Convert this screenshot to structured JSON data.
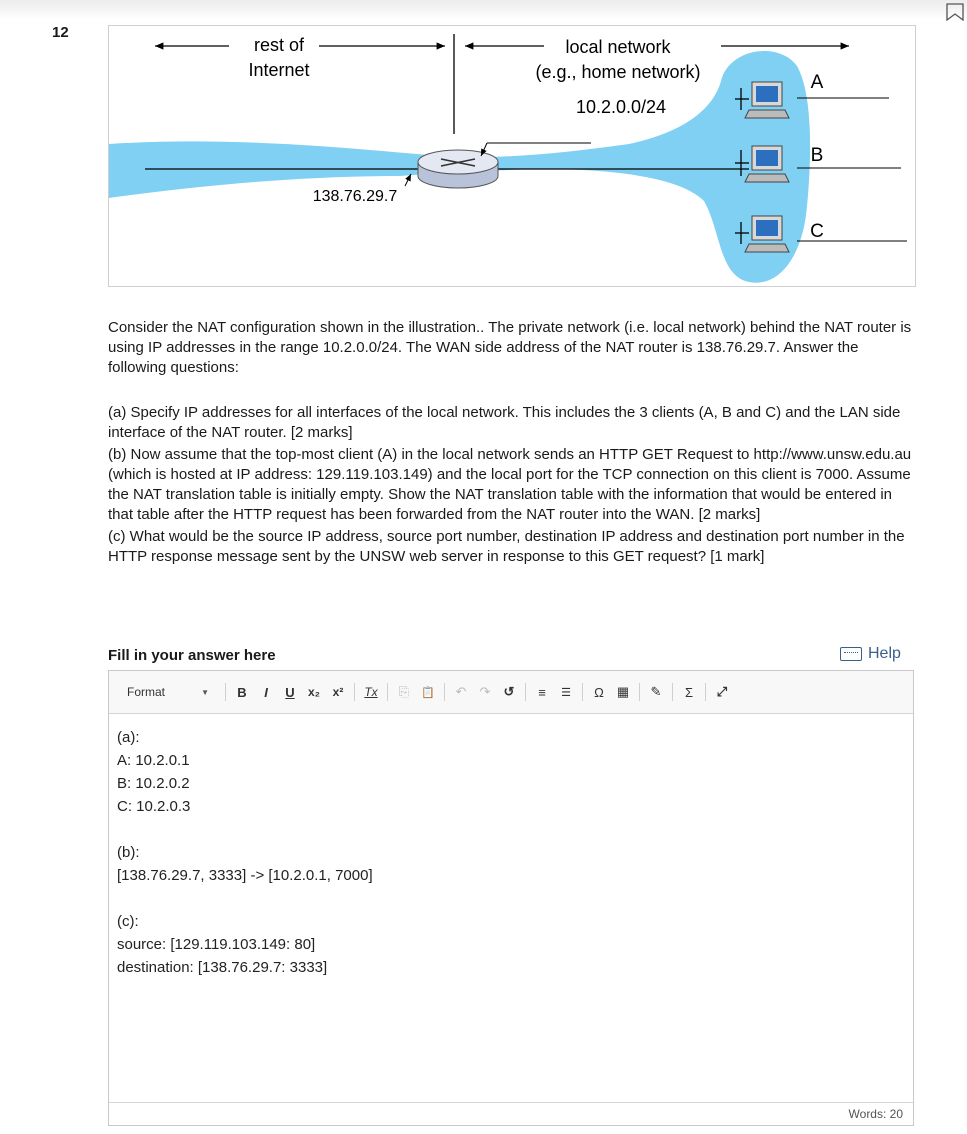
{
  "question_number": "12",
  "figure": {
    "label_rest": [
      "rest of",
      "Internet"
    ],
    "label_local": [
      "local network",
      "(e.g., home network)"
    ],
    "subnet": "10.2.0.0/24",
    "wan_ip": "138.76.29.7",
    "host_labels": [
      "A",
      "B",
      "C"
    ],
    "colors": {
      "cloud": "#7fd0f2",
      "router": "#d9e0ee",
      "line": "#000000"
    }
  },
  "question": {
    "intro": "Consider the NAT configuration shown in the illustration.. The private network (i.e. local network) behind the NAT router is using IP addresses in the range 10.2.0.0/24. The WAN side address of the NAT router is 138.76.29.7. Answer the following questions:",
    "part_a": "(a) Specify IP addresses for all interfaces of the local network. This includes the 3 clients (A, B and C) and the LAN side interface of the NAT router. [2 marks]",
    "part_b": "(b) Now assume that the top-most client (A) in the local network sends an HTTP GET Request to http://www.unsw.edu.au (which is hosted at IP address: 129.119.103.149) and the local port for the TCP connection on this client is 7000. Assume the NAT translation table is initially empty. Show the NAT translation table with the information that would be entered in that table after the HTTP request has been forwarded from the NAT router into the WAN. [2 marks]",
    "part_c": "(c)  What would be the source IP address, source port number, destination IP address and destination port number in the HTTP response message sent by the UNSW web server in response to this GET request? [1 mark]"
  },
  "answer_label": "Fill in your answer here",
  "help_label": "Help",
  "toolbar": {
    "format_label": "Format",
    "buttons": [
      {
        "name": "bold-button",
        "glyph": "B"
      },
      {
        "name": "italic-button",
        "glyph": "I"
      },
      {
        "name": "underline-button",
        "glyph": "U"
      },
      {
        "name": "subscript-button",
        "glyph": "x₂"
      },
      {
        "name": "superscript-button",
        "glyph": "x²"
      },
      {
        "name": "remove-format-button",
        "glyph": "Tx"
      },
      {
        "name": "copy-button",
        "glyph": "⎘"
      },
      {
        "name": "paste-button",
        "glyph": "📋"
      },
      {
        "name": "undo-button",
        "glyph": "↶"
      },
      {
        "name": "redo-button",
        "glyph": "↷"
      },
      {
        "name": "undo-alt-button",
        "glyph": "↺"
      },
      {
        "name": "numbered-list-button",
        "glyph": "≡"
      },
      {
        "name": "bulleted-list-button",
        "glyph": "☰"
      },
      {
        "name": "special-char-button",
        "glyph": "Ω"
      },
      {
        "name": "table-button",
        "glyph": "▦"
      },
      {
        "name": "edit-button",
        "glyph": "✎"
      },
      {
        "name": "equation-button",
        "glyph": "Σ"
      },
      {
        "name": "maximize-button",
        "glyph": "⤢"
      }
    ]
  },
  "answer_lines": [
    "(a):",
    "A: 10.2.0.1",
    "B: 10.2.0.2",
    "C: 10.2.0.3",
    "",
    "(b):",
    "[138.76.29.7, 3333] -> [10.2.0.1, 7000]",
    "",
    "(c):",
    "source: [129.119.103.149: 80]",
    "destination: [138.76.29.7: 3333]"
  ],
  "word_count": "Words: 20"
}
